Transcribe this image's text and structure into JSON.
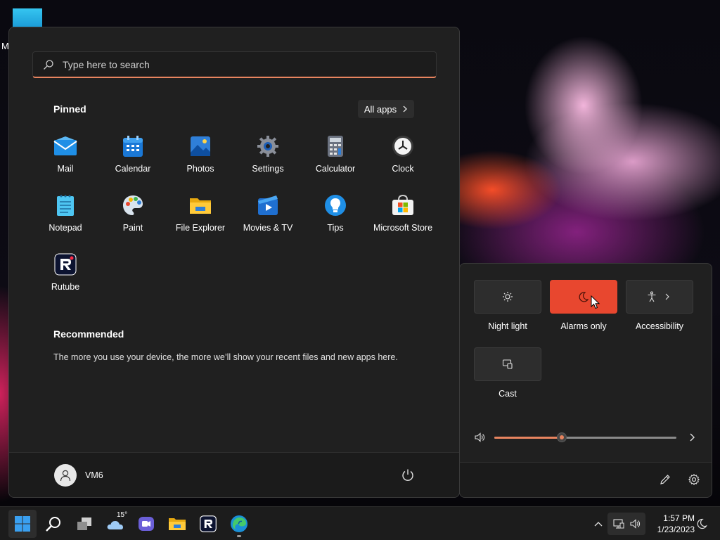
{
  "desktop": {
    "icon_label": "M"
  },
  "start_menu": {
    "search": {
      "placeholder": "Type here to search"
    },
    "pinned": {
      "title": "Pinned",
      "all_apps_label": "All apps",
      "apps": [
        {
          "label": "Mail",
          "icon": "mail-icon"
        },
        {
          "label": "Calendar",
          "icon": "calendar-icon"
        },
        {
          "label": "Photos",
          "icon": "photos-icon"
        },
        {
          "label": "Settings",
          "icon": "settings-gear-icon"
        },
        {
          "label": "Calculator",
          "icon": "calculator-icon"
        },
        {
          "label": "Clock",
          "icon": "clock-icon"
        },
        {
          "label": "Notepad",
          "icon": "notepad-icon"
        },
        {
          "label": "Paint",
          "icon": "paint-palette-icon"
        },
        {
          "label": "File Explorer",
          "icon": "folder-icon"
        },
        {
          "label": "Movies & TV",
          "icon": "movies-icon"
        },
        {
          "label": "Tips",
          "icon": "lightbulb-icon"
        },
        {
          "label": "Microsoft Store",
          "icon": "store-icon"
        },
        {
          "label": "Rutube",
          "icon": "rutube-icon"
        }
      ]
    },
    "recommended": {
      "title": "Recommended",
      "text": "The more you use your device, the more we’ll show your recent files and new apps here."
    },
    "footer": {
      "user_name": "VM6"
    }
  },
  "quick_settings": {
    "tiles": [
      {
        "label": "Night light",
        "icon": "brightness-icon",
        "active": false
      },
      {
        "label": "Alarms only",
        "icon": "moon-icon",
        "active": true
      },
      {
        "label": "Accessibility",
        "icon": "accessibility-icon",
        "active": false
      },
      {
        "label": "Cast",
        "icon": "cast-icon",
        "active": false
      }
    ],
    "volume": {
      "level": 0.37
    },
    "accent_color": "#e8472f"
  },
  "taskbar": {
    "weather_temp": "15°",
    "clock": {
      "time": "1:57 PM",
      "date": "1/23/2023"
    }
  }
}
